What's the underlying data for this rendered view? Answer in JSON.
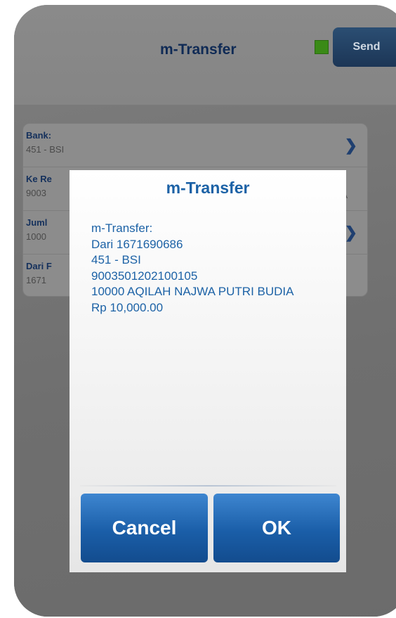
{
  "header": {
    "title": "m-Transfer",
    "send_label": "Send",
    "status_color": "#3a8a17"
  },
  "form": {
    "rows": [
      {
        "label": "Bank:",
        "value": "451 - BSI"
      },
      {
        "label": "Ke Re",
        "value": "9003",
        "tail": "IA"
      },
      {
        "label": "Juml",
        "value": "1000"
      },
      {
        "label": "Dari F",
        "value": "1671"
      }
    ]
  },
  "dialog": {
    "title": "m-Transfer",
    "lines": [
      "m-Transfer:",
      "Dari 1671690686",
      "451 - BSI",
      "9003501202100105",
      "10000 AQILAH NAJWA PUTRI BUDIA",
      "Rp 10,000.00"
    ],
    "cancel_label": "Cancel",
    "ok_label": "OK",
    "accent_color": "#1c62a6"
  }
}
